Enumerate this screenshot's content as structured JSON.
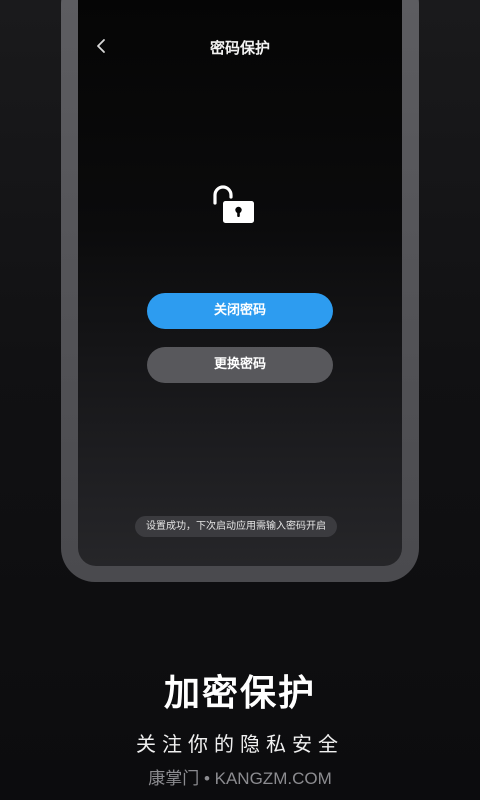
{
  "screen": {
    "nav": {
      "title": "密码保护",
      "back_icon": "chevron-left-icon"
    },
    "lock_icon": "unlocked-padlock-icon",
    "buttons": {
      "close_password": "关闭密码",
      "change_password": "更换密码"
    },
    "toast": "设置成功，下次启动应用需输入密码开启",
    "colors": {
      "primary_button": "#2d9cf0",
      "secondary_button": "#58585c"
    }
  },
  "promo": {
    "headline": "加密保护",
    "subline": "关注你的隐私安全",
    "watermark": "康掌门 • KANGZM.COM"
  }
}
